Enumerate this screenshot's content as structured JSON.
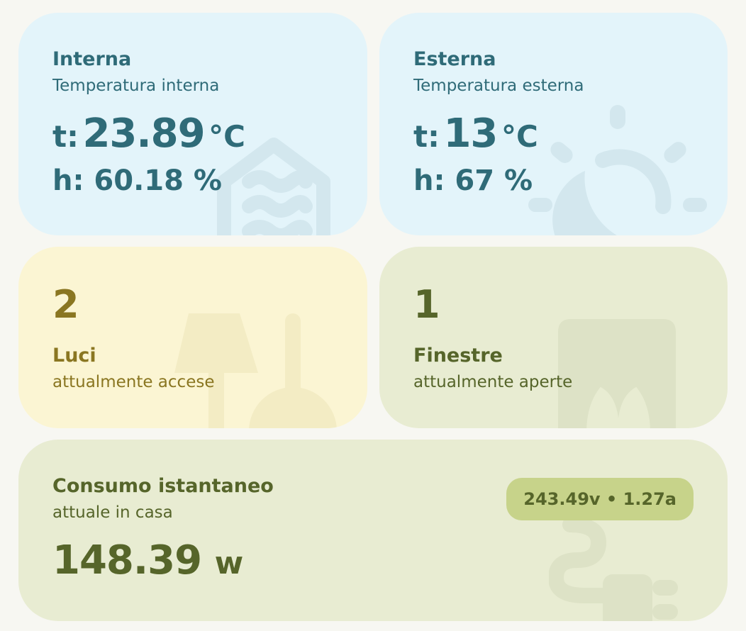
{
  "internal": {
    "title": "Interna",
    "subtitle": "Temperatura interna",
    "temp_label": "t:",
    "temp_value": "23.89",
    "temp_unit": "°C",
    "hum_label": "h:",
    "hum_value": "60.18",
    "hum_unit": "%",
    "icon": "home-thermometer-icon"
  },
  "external": {
    "title": "Esterna",
    "subtitle": "Temperatura esterna",
    "temp_label": "t:",
    "temp_value": "13",
    "temp_unit": "°C",
    "hum_label": "h:",
    "hum_value": "67",
    "hum_unit": "%",
    "icon": "weather-sun-moon-icon"
  },
  "lights": {
    "count": "2",
    "title": "Luci",
    "subtitle": "attualmente accese",
    "icon": "lamp-icon"
  },
  "windows": {
    "count": "1",
    "title": "Finestre",
    "subtitle": "attualmente aperte",
    "icon": "window-curtains-icon"
  },
  "power": {
    "title": "Consumo istantaneo",
    "subtitle": "attuale in casa",
    "badge": "243.49v • 1.27a",
    "value": "148.39",
    "unit": "w",
    "icon": "power-plug-icon"
  },
  "colors": {
    "page_bg": "#f7f7f2",
    "blue_card": "#e3f4fa",
    "blue_text": "#2f6b78",
    "yellow_card": "#fbf5d3",
    "yellow_text": "#8a7621",
    "green_card": "#e8ecd2",
    "green_text": "#56652a",
    "pill_bg": "#c7d38a"
  }
}
